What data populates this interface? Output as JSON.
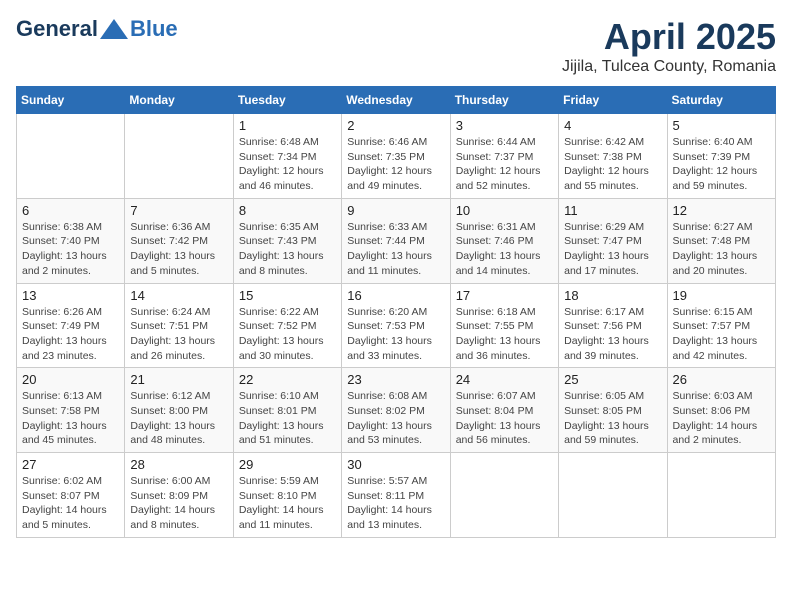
{
  "header": {
    "logo_general": "General",
    "logo_blue": "Blue",
    "title": "April 2025",
    "subtitle": "Jijila, Tulcea County, Romania"
  },
  "weekdays": [
    "Sunday",
    "Monday",
    "Tuesday",
    "Wednesday",
    "Thursday",
    "Friday",
    "Saturday"
  ],
  "weeks": [
    [
      {
        "day": "",
        "info": ""
      },
      {
        "day": "",
        "info": ""
      },
      {
        "day": "1",
        "info": "Sunrise: 6:48 AM\nSunset: 7:34 PM\nDaylight: 12 hours and 46 minutes."
      },
      {
        "day": "2",
        "info": "Sunrise: 6:46 AM\nSunset: 7:35 PM\nDaylight: 12 hours and 49 minutes."
      },
      {
        "day": "3",
        "info": "Sunrise: 6:44 AM\nSunset: 7:37 PM\nDaylight: 12 hours and 52 minutes."
      },
      {
        "day": "4",
        "info": "Sunrise: 6:42 AM\nSunset: 7:38 PM\nDaylight: 12 hours and 55 minutes."
      },
      {
        "day": "5",
        "info": "Sunrise: 6:40 AM\nSunset: 7:39 PM\nDaylight: 12 hours and 59 minutes."
      }
    ],
    [
      {
        "day": "6",
        "info": "Sunrise: 6:38 AM\nSunset: 7:40 PM\nDaylight: 13 hours and 2 minutes."
      },
      {
        "day": "7",
        "info": "Sunrise: 6:36 AM\nSunset: 7:42 PM\nDaylight: 13 hours and 5 minutes."
      },
      {
        "day": "8",
        "info": "Sunrise: 6:35 AM\nSunset: 7:43 PM\nDaylight: 13 hours and 8 minutes."
      },
      {
        "day": "9",
        "info": "Sunrise: 6:33 AM\nSunset: 7:44 PM\nDaylight: 13 hours and 11 minutes."
      },
      {
        "day": "10",
        "info": "Sunrise: 6:31 AM\nSunset: 7:46 PM\nDaylight: 13 hours and 14 minutes."
      },
      {
        "day": "11",
        "info": "Sunrise: 6:29 AM\nSunset: 7:47 PM\nDaylight: 13 hours and 17 minutes."
      },
      {
        "day": "12",
        "info": "Sunrise: 6:27 AM\nSunset: 7:48 PM\nDaylight: 13 hours and 20 minutes."
      }
    ],
    [
      {
        "day": "13",
        "info": "Sunrise: 6:26 AM\nSunset: 7:49 PM\nDaylight: 13 hours and 23 minutes."
      },
      {
        "day": "14",
        "info": "Sunrise: 6:24 AM\nSunset: 7:51 PM\nDaylight: 13 hours and 26 minutes."
      },
      {
        "day": "15",
        "info": "Sunrise: 6:22 AM\nSunset: 7:52 PM\nDaylight: 13 hours and 30 minutes."
      },
      {
        "day": "16",
        "info": "Sunrise: 6:20 AM\nSunset: 7:53 PM\nDaylight: 13 hours and 33 minutes."
      },
      {
        "day": "17",
        "info": "Sunrise: 6:18 AM\nSunset: 7:55 PM\nDaylight: 13 hours and 36 minutes."
      },
      {
        "day": "18",
        "info": "Sunrise: 6:17 AM\nSunset: 7:56 PM\nDaylight: 13 hours and 39 minutes."
      },
      {
        "day": "19",
        "info": "Sunrise: 6:15 AM\nSunset: 7:57 PM\nDaylight: 13 hours and 42 minutes."
      }
    ],
    [
      {
        "day": "20",
        "info": "Sunrise: 6:13 AM\nSunset: 7:58 PM\nDaylight: 13 hours and 45 minutes."
      },
      {
        "day": "21",
        "info": "Sunrise: 6:12 AM\nSunset: 8:00 PM\nDaylight: 13 hours and 48 minutes."
      },
      {
        "day": "22",
        "info": "Sunrise: 6:10 AM\nSunset: 8:01 PM\nDaylight: 13 hours and 51 minutes."
      },
      {
        "day": "23",
        "info": "Sunrise: 6:08 AM\nSunset: 8:02 PM\nDaylight: 13 hours and 53 minutes."
      },
      {
        "day": "24",
        "info": "Sunrise: 6:07 AM\nSunset: 8:04 PM\nDaylight: 13 hours and 56 minutes."
      },
      {
        "day": "25",
        "info": "Sunrise: 6:05 AM\nSunset: 8:05 PM\nDaylight: 13 hours and 59 minutes."
      },
      {
        "day": "26",
        "info": "Sunrise: 6:03 AM\nSunset: 8:06 PM\nDaylight: 14 hours and 2 minutes."
      }
    ],
    [
      {
        "day": "27",
        "info": "Sunrise: 6:02 AM\nSunset: 8:07 PM\nDaylight: 14 hours and 5 minutes."
      },
      {
        "day": "28",
        "info": "Sunrise: 6:00 AM\nSunset: 8:09 PM\nDaylight: 14 hours and 8 minutes."
      },
      {
        "day": "29",
        "info": "Sunrise: 5:59 AM\nSunset: 8:10 PM\nDaylight: 14 hours and 11 minutes."
      },
      {
        "day": "30",
        "info": "Sunrise: 5:57 AM\nSunset: 8:11 PM\nDaylight: 14 hours and 13 minutes."
      },
      {
        "day": "",
        "info": ""
      },
      {
        "day": "",
        "info": ""
      },
      {
        "day": "",
        "info": ""
      }
    ]
  ]
}
